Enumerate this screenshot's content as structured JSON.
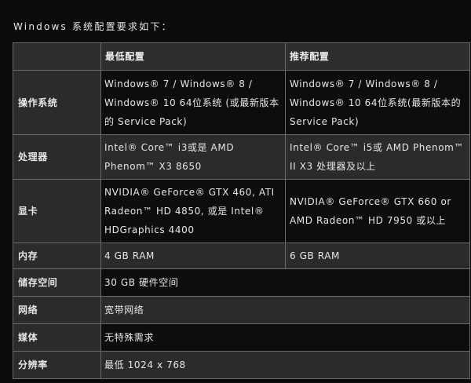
{
  "heading": "Windows 系统配置要求如下：",
  "table": {
    "columns": [
      "",
      "最低配置",
      "推荐配置"
    ],
    "rows": [
      {
        "label": "操作系统",
        "min": "Windows® 7 / Windows® 8 / Windows® 10 64位系统 (或最新版本的 Service Pack)",
        "rec": "Windows® 7 / Windows® 8 / Windows® 10 64位系统(最新版本的 Service Pack)"
      },
      {
        "label": "处理器",
        "min": "Intel® Core™ i3或是 AMD Phenom™ X3 8650",
        "rec": "Intel® Core™ i5或 AMD Phenom™ II X3 处理器及以上"
      },
      {
        "label": "显卡",
        "min": "NVIDIA® GeForce® GTX 460, ATI Radeon™ HD 4850, 或是 Intel® HDGraphics 4400",
        "rec": "NVIDIA® GeForce® GTX 660 or AMD Radeon™ HD 7950 或以上"
      },
      {
        "label": "内存",
        "min": "4 GB RAM",
        "rec": "6 GB RAM"
      },
      {
        "label": "储存空间",
        "value": "30 GB 硬件空间"
      },
      {
        "label": "网络",
        "value": "宽带网络"
      },
      {
        "label": "媒体",
        "value": "无特殊需求"
      },
      {
        "label": "分辨率",
        "value": "最低 1024 x 768"
      }
    ]
  }
}
